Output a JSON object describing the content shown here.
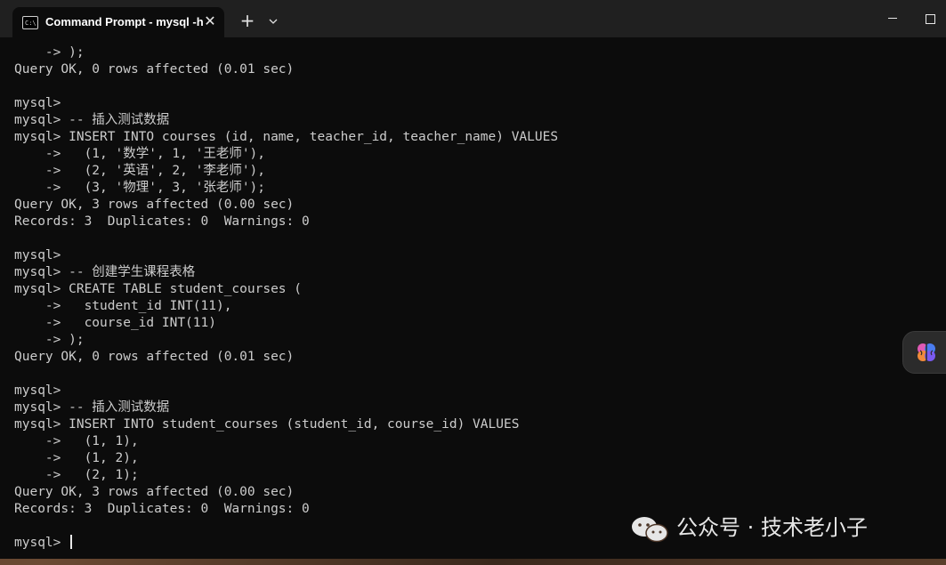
{
  "window": {
    "tab_title": "Command Prompt - mysql  -h",
    "tab_close": "✕",
    "new_tab": "+",
    "dropdown": "⌄"
  },
  "terminal": {
    "lines": [
      "    -> );",
      "Query OK, 0 rows affected (0.01 sec)",
      "",
      "mysql>",
      "mysql> -- 插入测试数据",
      "mysql> INSERT INTO courses (id, name, teacher_id, teacher_name) VALUES",
      "    ->   (1, '数学', 1, '王老师'),",
      "    ->   (2, '英语', 2, '李老师'),",
      "    ->   (3, '物理', 3, '张老师');",
      "Query OK, 3 rows affected (0.00 sec)",
      "Records: 3  Duplicates: 0  Warnings: 0",
      "",
      "mysql>",
      "mysql> -- 创建学生课程表格",
      "mysql> CREATE TABLE student_courses (",
      "    ->   student_id INT(11),",
      "    ->   course_id INT(11)",
      "    -> );",
      "Query OK, 0 rows affected (0.01 sec)",
      "",
      "mysql>",
      "mysql> -- 插入测试数据",
      "mysql> INSERT INTO student_courses (student_id, course_id) VALUES",
      "    ->   (1, 1),",
      "    ->   (1, 2),",
      "    ->   (2, 1);",
      "Query OK, 3 rows affected (0.00 sec)",
      "Records: 3  Duplicates: 0  Warnings: 0",
      ""
    ],
    "prompt": "mysql> "
  },
  "watermark": {
    "text": "公众号 · 技术老小子",
    "icon": "wechat-icon"
  },
  "colors": {
    "terminal_bg": "#0c0c0c",
    "terminal_fg": "#cccccc",
    "titlebar_bg": "#202020"
  }
}
